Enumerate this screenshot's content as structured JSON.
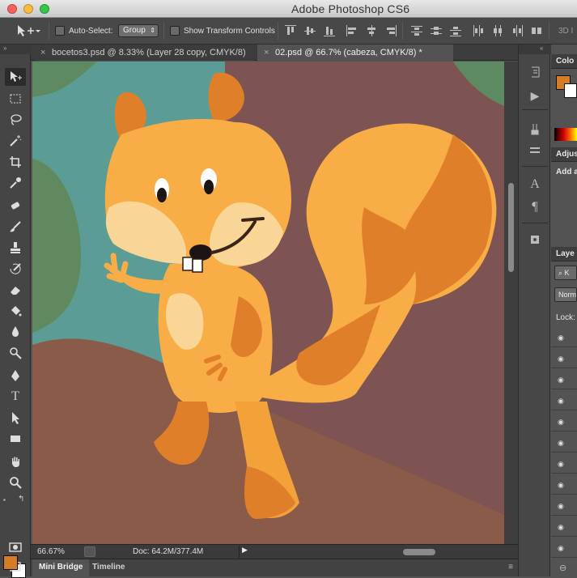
{
  "window": {
    "title": "Adobe Photoshop CS6"
  },
  "options_bar": {
    "auto_select_label": "Auto-Select:",
    "auto_select_value": "Group",
    "transform_label": "Show Transform Controls",
    "mode_3d_label": "3D I"
  },
  "tabs": [
    {
      "label": "bocetos3.psd @ 8.33% (Layer 28 copy, CMYK/8)"
    },
    {
      "label": "02.psd @ 66.7% (cabeza, CMYK/8) *"
    }
  ],
  "status": {
    "zoom": "66.67%",
    "doc": "Doc: 64.2M/377.4M"
  },
  "bottom_tabs": [
    {
      "label": "Mini Bridge"
    },
    {
      "label": "Timeline"
    }
  ],
  "panels": {
    "color_title": "Colo",
    "adjust_title": "Adjus",
    "adjust_add": "Add a",
    "layers_title": "Laye",
    "layers_filter": "K",
    "blend_mode": "Norm",
    "lock_label": "Lock:"
  },
  "colors": {
    "foreground": "#d57d26",
    "background": "#ffffff"
  }
}
